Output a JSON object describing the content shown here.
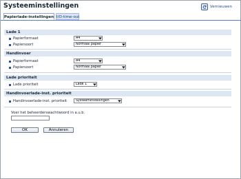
{
  "header": {
    "title": "Systeeminstellingen",
    "refresh_label": "Vernieuwen",
    "refresh_icon": "refresh-icon"
  },
  "tabs": [
    {
      "label": "Papierlade-instellingen",
      "active": true
    },
    {
      "label": "I/O-time-out",
      "active": false
    }
  ],
  "sections": {
    "lade1": {
      "title": "Lade 1",
      "papierformaat": {
        "label": "Papierformaat",
        "value": "A4"
      },
      "papiersoort": {
        "label": "Papiersoort",
        "value": "Normaal papier"
      }
    },
    "handinvoer": {
      "title": "Handinvoer",
      "papierformaat": {
        "label": "Papierformaat",
        "value": "A4"
      },
      "papiersoort": {
        "label": "Papiersoort",
        "value": "Normaal papier"
      }
    },
    "lade_prioriteit": {
      "title": "Lade prioriteit",
      "lade_prioriteit": {
        "label": "Lade prioriteit",
        "value": "Lade 1"
      }
    },
    "handinvoerlade_inst": {
      "title": "Handinvoerlade-inst. prioriteit",
      "prioriteit": {
        "label": "Handinvoerlade-inst. prioriteit",
        "value": "Systeeminstellingen"
      }
    }
  },
  "password": {
    "label": "Voer het beheerderswachtwoord in a.u.b.",
    "value": ""
  },
  "buttons": {
    "ok": "OK",
    "cancel": "Annuleren"
  },
  "colors": {
    "section_bg": "#dde7f3",
    "tab_border": "#5a7ec4",
    "bullet": "#2d4f9c"
  }
}
